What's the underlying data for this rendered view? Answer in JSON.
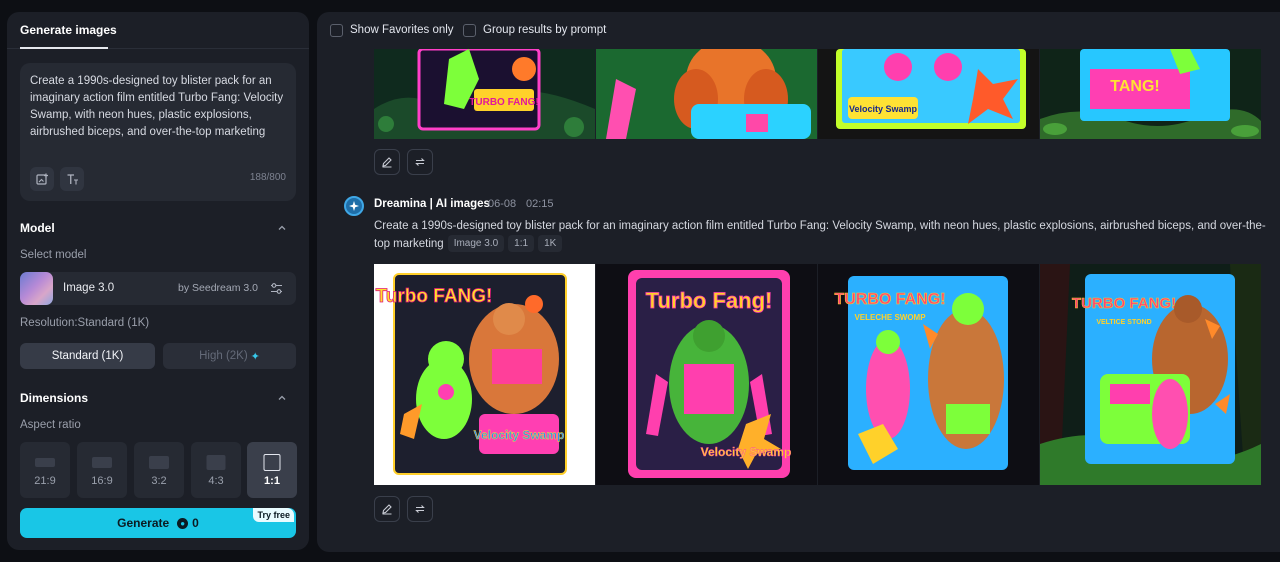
{
  "sidebar": {
    "tab_active": "Generate images",
    "prompt": {
      "text": "Create a 1990s-designed toy blister pack for an imaginary action film entitled Turbo Fang: Velocity Swamp, with neon hues, plastic explosions, airbrushed biceps, and over-the-top marketing",
      "count": "188/800"
    },
    "model": {
      "section_title": "Model",
      "select_label": "Select model",
      "name": "Image 3.0",
      "by": "by Seedream 3.0"
    },
    "resolution": {
      "label": "Resolution:Standard (1K)",
      "standard": "Standard (1K)",
      "high": "High (2K)",
      "high_icon": "✦"
    },
    "dimensions": {
      "section_title": "Dimensions",
      "aspect_label": "Aspect ratio",
      "ratios": [
        "21:9",
        "16:9",
        "3:2",
        "4:3",
        "1:1"
      ],
      "selected": "1:1"
    },
    "generate": {
      "label": "Generate",
      "cost": "0",
      "badge": "Try free"
    }
  },
  "main": {
    "filters": {
      "favorites": "Show Favorites only",
      "group": "Group results by prompt"
    },
    "result": {
      "author": "Dreamina | AI images",
      "date": "06-08",
      "time": "02:15",
      "prompt": "Create a 1990s-designed toy blister pack for an imaginary action film entitled Turbo Fang: Velocity Swamp, with neon hues, plastic explosions, airbrushed biceps, and over-the-top marketing",
      "tags": [
        "Image 3.0",
        "1:1",
        "1K"
      ],
      "images": [
        {
          "title": "Turbo FANG!",
          "subtitle": "Velocity Swamp"
        },
        {
          "title": "Turbo Fang!",
          "subtitle": "Velocity Swamp"
        },
        {
          "title": "TURBO FANG!",
          "subtitle": "VELECHE SWOMP"
        },
        {
          "title": "TURBO FANG!",
          "subtitle": "VELTICE STOND"
        }
      ]
    },
    "previous_images": [
      {
        "title": "TURBO FANG!"
      },
      {
        "title": ""
      },
      {
        "title": "Velocity Swamp"
      },
      {
        "title": "TANG!"
      }
    ]
  },
  "colors": {
    "accent": "#19c6e6",
    "panel": "#1c1f27",
    "background": "#0d0f14"
  },
  "icons": {
    "upload": "image-add-icon",
    "text": "text-style-icon",
    "settings": "sliders-icon",
    "edit": "pencil-icon",
    "regenerate": "regenerate-icon",
    "chevron": "chevron-up-icon"
  }
}
